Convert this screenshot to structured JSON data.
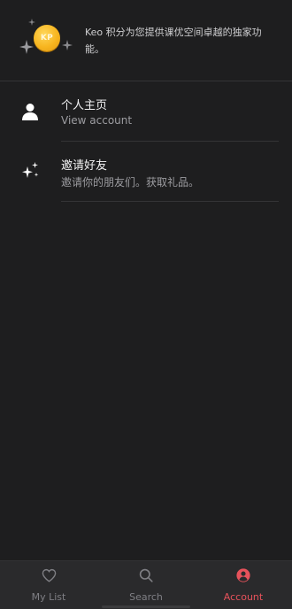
{
  "promo": {
    "coin_text": "KP",
    "text": "Keo 积分为您提供课优空间卓越的独家功能。",
    "coin_color": "#f7b51f"
  },
  "menu": {
    "items": [
      {
        "icon": "person-icon",
        "title": "个人主页",
        "subtitle": "View account"
      },
      {
        "icon": "sparkles-icon",
        "title": "邀请好友",
        "subtitle": "邀请你的朋友们。获取礼品。"
      }
    ]
  },
  "tabbar": {
    "tabs": [
      {
        "icon": "heart-icon",
        "label": "My List",
        "active": false
      },
      {
        "icon": "search-icon",
        "label": "Search",
        "active": false
      },
      {
        "icon": "account-icon",
        "label": "Account",
        "active": true
      }
    ],
    "active_color": "#e7525b"
  }
}
